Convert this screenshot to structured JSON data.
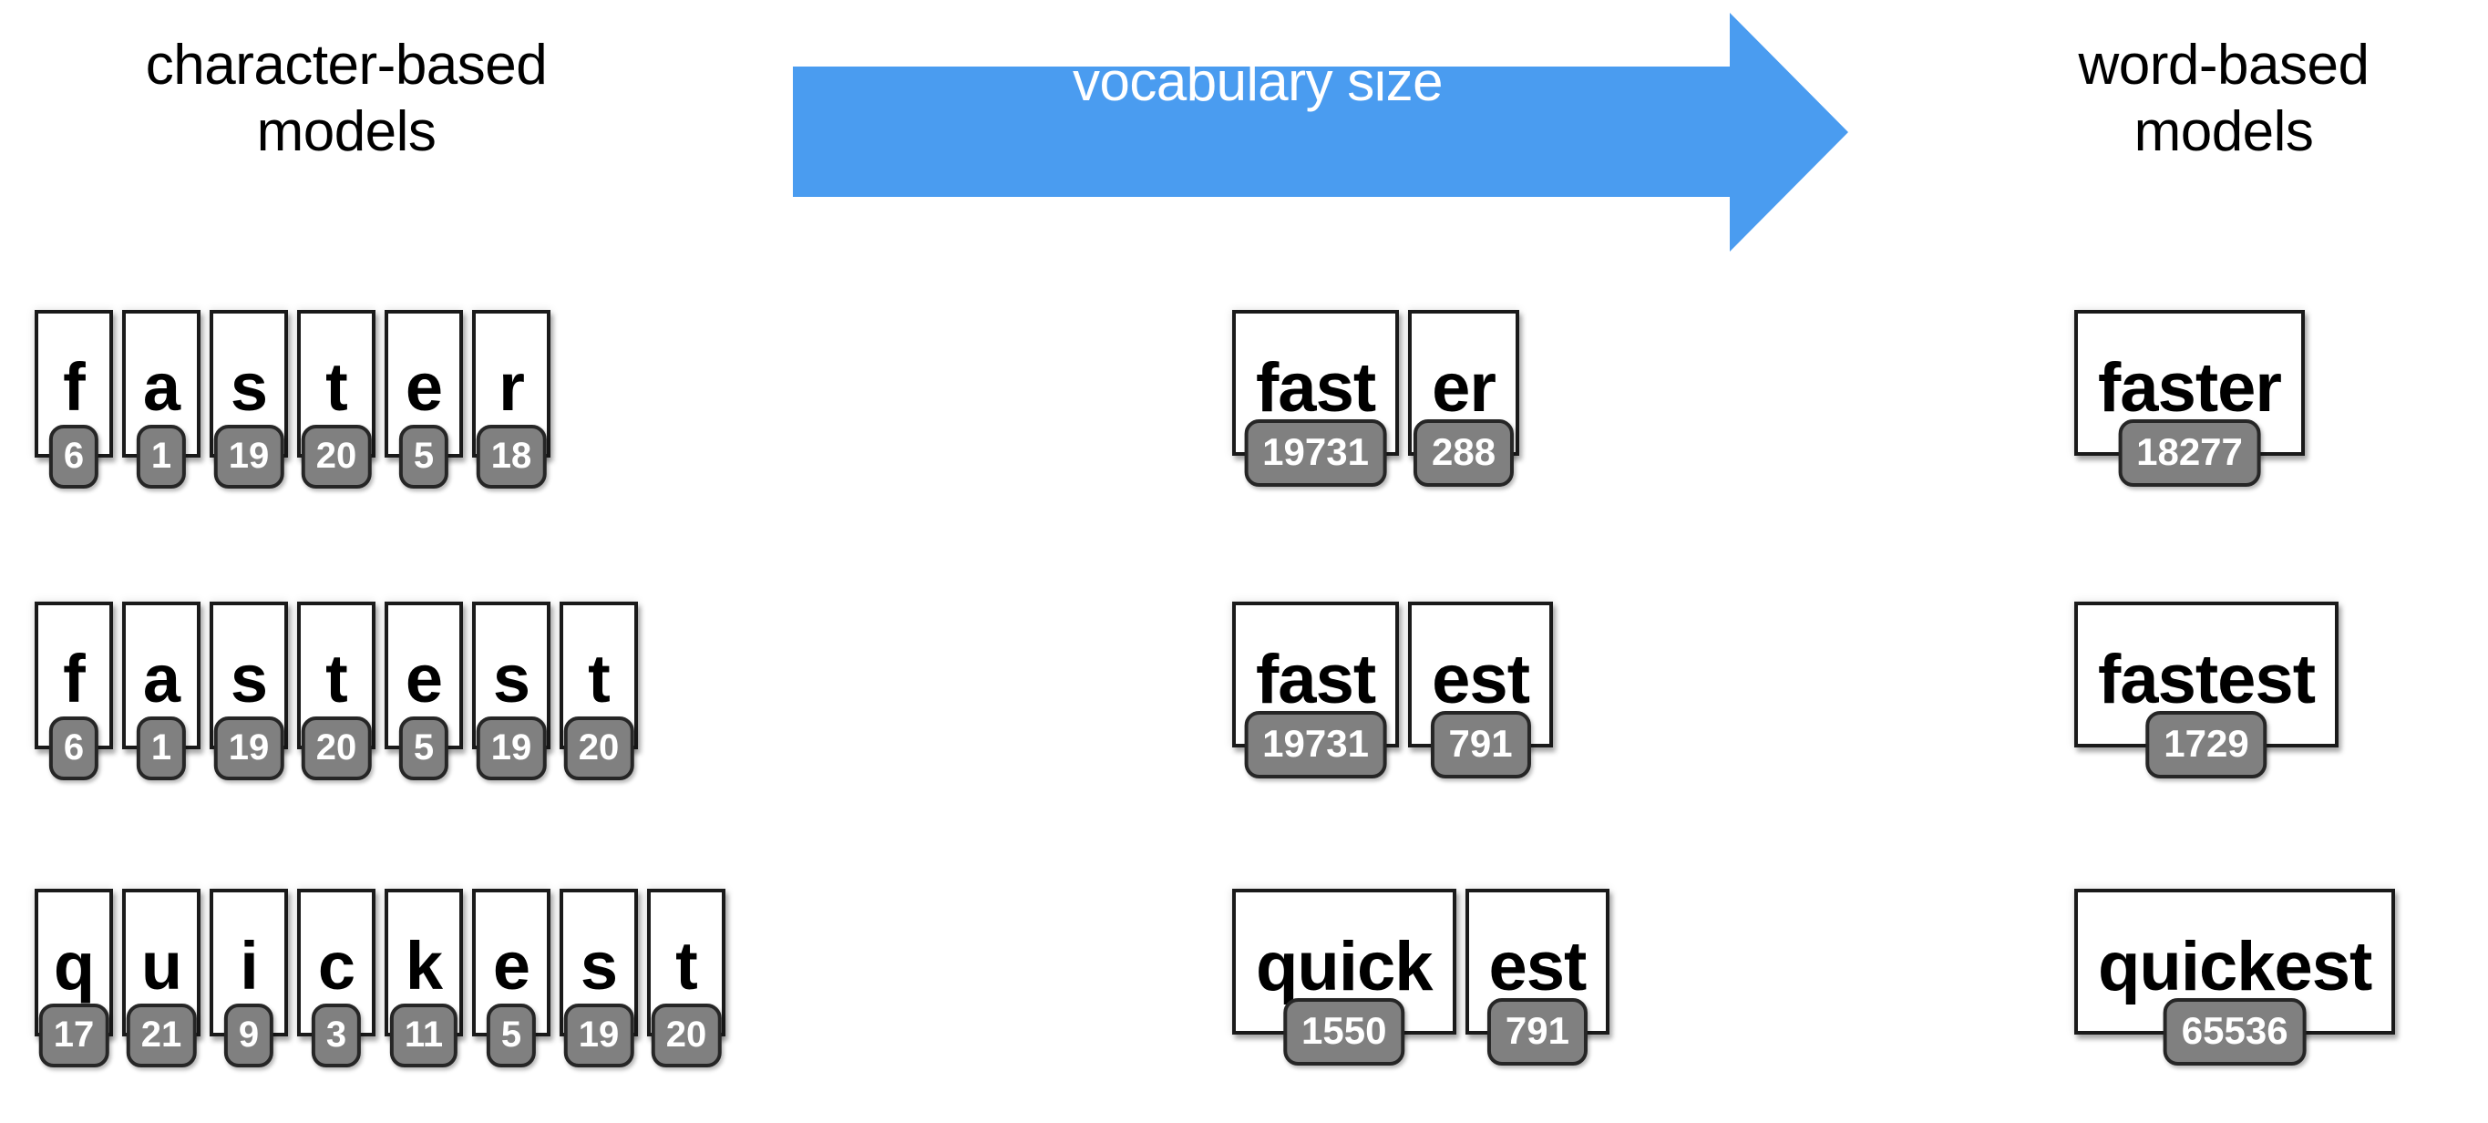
{
  "headings": {
    "left": "character-based\nmodels",
    "right": "word-based\nmodels"
  },
  "arrow": {
    "label": "vocabulary size",
    "color": "#4a9cf0",
    "direction": "right"
  },
  "colors": {
    "tile_border": "#1a1a1a",
    "tile_fill": "#ffffff",
    "badge_fill": "#808080",
    "badge_border": "#262626",
    "badge_text": "#ffffff",
    "text": "#000000",
    "background": "#ffffff"
  },
  "rows": [
    {
      "word": "faster",
      "characters": [
        {
          "label": "f",
          "id": "6"
        },
        {
          "label": "a",
          "id": "1"
        },
        {
          "label": "s",
          "id": "19"
        },
        {
          "label": "t",
          "id": "20"
        },
        {
          "label": "e",
          "id": "5"
        },
        {
          "label": "r",
          "id": "18"
        }
      ],
      "subwords": [
        {
          "label": "fast",
          "id": "19731"
        },
        {
          "label": "er",
          "id": "288"
        }
      ],
      "words": [
        {
          "label": "faster",
          "id": "18277"
        }
      ]
    },
    {
      "word": "fastest",
      "characters": [
        {
          "label": "f",
          "id": "6"
        },
        {
          "label": "a",
          "id": "1"
        },
        {
          "label": "s",
          "id": "19"
        },
        {
          "label": "t",
          "id": "20"
        },
        {
          "label": "e",
          "id": "5"
        },
        {
          "label": "s",
          "id": "19"
        },
        {
          "label": "t",
          "id": "20"
        }
      ],
      "subwords": [
        {
          "label": "fast",
          "id": "19731"
        },
        {
          "label": "est",
          "id": "791"
        }
      ],
      "words": [
        {
          "label": "fastest",
          "id": "1729"
        }
      ]
    },
    {
      "word": "quickest",
      "characters": [
        {
          "label": "q",
          "id": "17"
        },
        {
          "label": "u",
          "id": "21"
        },
        {
          "label": "i",
          "id": "9"
        },
        {
          "label": "c",
          "id": "3"
        },
        {
          "label": "k",
          "id": "11"
        },
        {
          "label": "e",
          "id": "5"
        },
        {
          "label": "s",
          "id": "19"
        },
        {
          "label": "t",
          "id": "20"
        }
      ],
      "subwords": [
        {
          "label": "quick",
          "id": "1550"
        },
        {
          "label": "est",
          "id": "791"
        }
      ],
      "words": [
        {
          "label": "quickest",
          "id": "65536"
        }
      ]
    }
  ]
}
